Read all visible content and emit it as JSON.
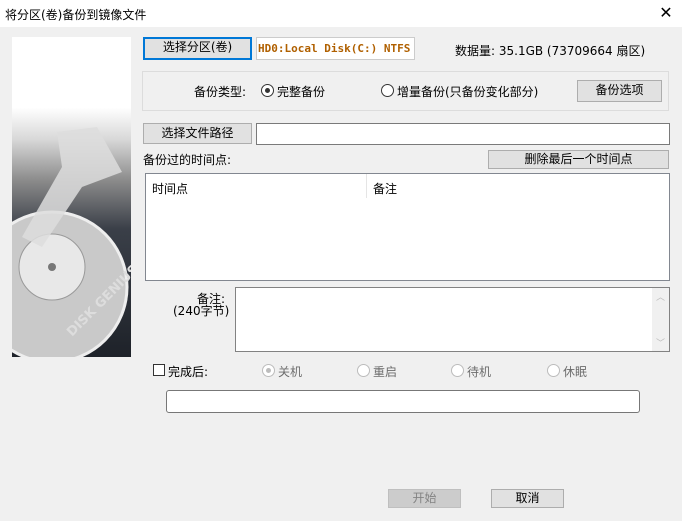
{
  "window": {
    "title": "将分区(卷)备份到镜像文件",
    "close_icon": "close-icon"
  },
  "image": {
    "caption": "DISK GENIUS"
  },
  "source": {
    "select_button": "选择分区(卷)",
    "partition": "HD0:Local Disk(C:) NTFS",
    "data_size": "数据量: 35.1GB (73709664 扇区)"
  },
  "backup_type": {
    "label": "备份类型:",
    "full": "完整备份",
    "incremental": "增量备份(只备份变化部分)",
    "selected": "full",
    "options_button": "备份选项"
  },
  "path": {
    "select_button": "选择文件路径",
    "value": ""
  },
  "timepoints": {
    "label": "备份过的时间点:",
    "delete_button": "删除最后一个时间点",
    "columns": [
      "时间点",
      "备注"
    ],
    "rows": []
  },
  "note": {
    "label": "备注:",
    "limit": "(240字节)",
    "value": ""
  },
  "after": {
    "checkbox_label": "完成后:",
    "checked": false,
    "options": [
      "关机",
      "重启",
      "待机",
      "休眠"
    ],
    "selected": "关机"
  },
  "progress": {
    "value": 0
  },
  "footer": {
    "start": "开始",
    "cancel": "取消"
  }
}
